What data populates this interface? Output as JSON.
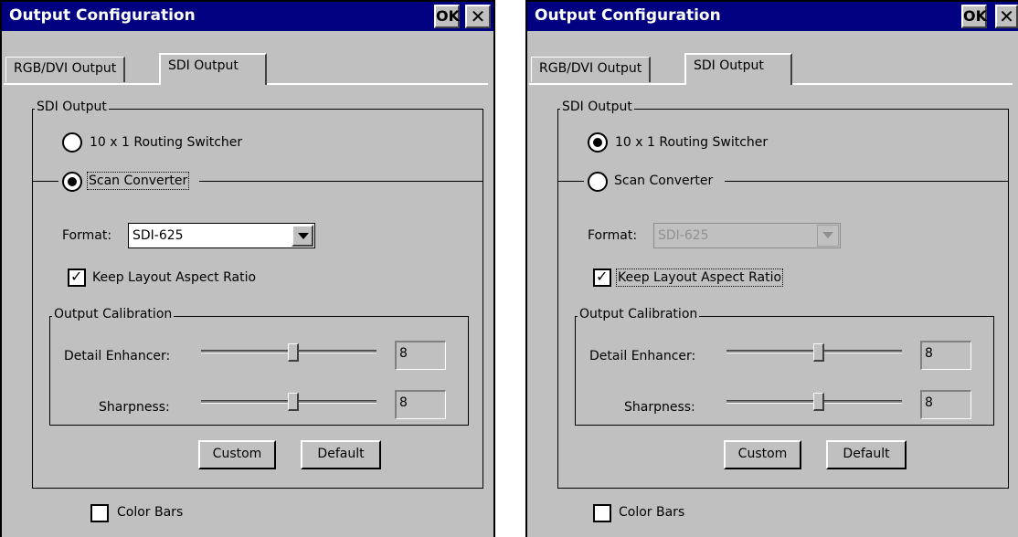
{
  "dialogs": [
    {
      "title": "Output Configuration",
      "ok_label": "OK",
      "close_label": "✕",
      "tabs": [
        "RGB/DVI Output",
        "SDI Output"
      ],
      "sdi_group_label": "SDI Output",
      "radio_routing_label": "10 x 1 Routing Switcher",
      "radio_scan_label": "Scan Converter",
      "selected_mode": "scan-converter",
      "format_label": "Format:",
      "format_value": "SDI-625",
      "format_enabled": true,
      "keep_aspect_label": "Keep Layout Aspect Ratio",
      "keep_aspect_checked": true,
      "calibration_group_label": "Output Calibration",
      "detail_label": "Detail Enhancer:",
      "detail_value": "8",
      "sharpness_label": "Sharpness:",
      "sharpness_value": "8",
      "custom_label": "Custom",
      "default_label": "Default",
      "color_bars_label": "Color Bars",
      "color_bars_checked": false
    },
    {
      "title": "Output Configuration",
      "ok_label": "OK",
      "close_label": "✕",
      "tabs": [
        "RGB/DVI Output",
        "SDI Output"
      ],
      "sdi_group_label": "SDI Output",
      "radio_routing_label": "10 x 1 Routing Switcher",
      "radio_scan_label": "Scan Converter",
      "selected_mode": "routing-switcher",
      "format_label": "Format:",
      "format_value": "SDI-625",
      "format_enabled": false,
      "keep_aspect_label": "Keep Layout Aspect Ratio",
      "keep_aspect_checked": true,
      "calibration_group_label": "Output Calibration",
      "detail_label": "Detail Enhancer:",
      "detail_value": "8",
      "sharpness_label": "Sharpness:",
      "sharpness_value": "8",
      "custom_label": "Custom",
      "default_label": "Default",
      "color_bars_label": "Color Bars",
      "color_bars_checked": false
    }
  ],
  "colors": {
    "titlebar": "#000080",
    "face": "#c0c0c0"
  }
}
